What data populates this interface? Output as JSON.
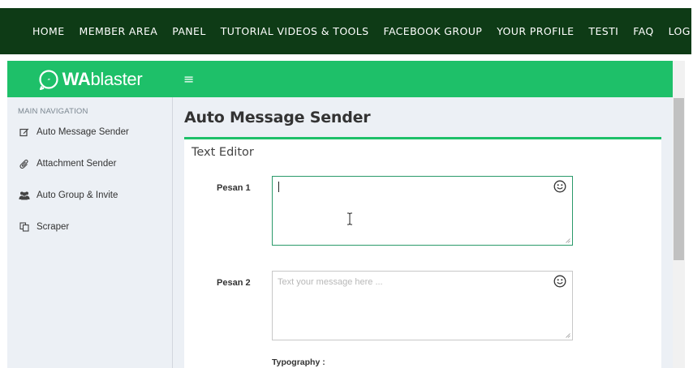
{
  "topnav": {
    "items": [
      "HOME",
      "MEMBER AREA",
      "PANEL",
      "TUTORIAL VIDEOS & TOOLS",
      "FACEBOOK GROUP",
      "YOUR PROFILE",
      "TESTI",
      "FAQ",
      "LOG OUT"
    ]
  },
  "header": {
    "logo_bold": "WA",
    "logo_rest": "blaster",
    "menu_icon": "≡"
  },
  "sidebar": {
    "title": "MAIN NAVIGATION",
    "items": [
      {
        "label": "Auto Message Sender",
        "icon": "edit-icon"
      },
      {
        "label": "Attachment Sender",
        "icon": "paperclip-icon"
      },
      {
        "label": "Auto Group & Invite",
        "icon": "users-icon"
      },
      {
        "label": "Scraper",
        "icon": "copy-icon"
      }
    ]
  },
  "main": {
    "page_title": "Auto Message Sender",
    "box_title": "Text Editor",
    "fields": [
      {
        "label": "Pesan 1",
        "value": "",
        "placeholder": ""
      },
      {
        "label": "Pesan 2",
        "value": "",
        "placeholder": "Text your message here ..."
      }
    ],
    "typography_label": "Typography :"
  },
  "colors": {
    "topnav_bg": "#0e3b16",
    "brand_green": "#1ec069",
    "sidebar_bg": "#ecf0f5"
  }
}
